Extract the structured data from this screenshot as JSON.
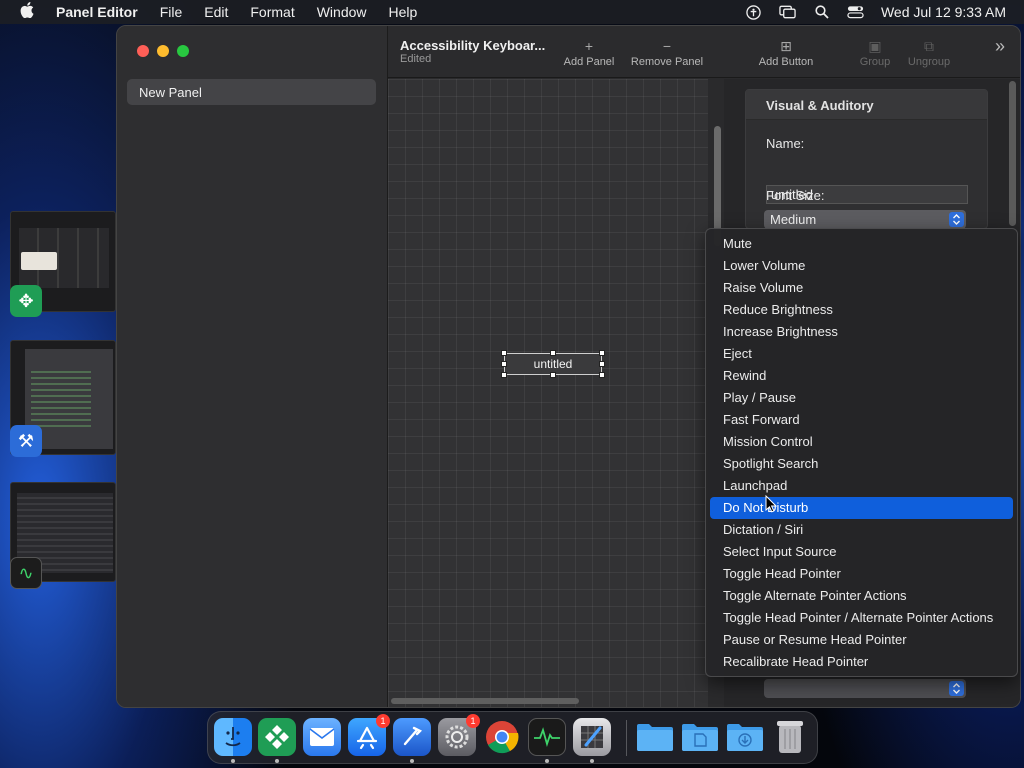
{
  "menubar": {
    "app_name": "Panel Editor",
    "menus": [
      "File",
      "Edit",
      "Format",
      "Window",
      "Help"
    ],
    "clock": "Wed Jul 12  9:33 AM",
    "status_icons": [
      "accessibility-icon",
      "screen-mirror-icon",
      "search-icon",
      "control-center-icon"
    ]
  },
  "sidebar": {
    "items": [
      {
        "label": "New Panel"
      }
    ]
  },
  "toolbar": {
    "doc_title": "Accessibility Keyboar...",
    "doc_status": "Edited",
    "buttons": [
      {
        "label": "Add Panel",
        "icon": "+",
        "enabled": true
      },
      {
        "label": "Remove Panel",
        "icon": "−",
        "enabled": true
      },
      {
        "label": "Add Button",
        "icon": "⊞",
        "enabled": true
      },
      {
        "label": "Group",
        "icon": "▣",
        "enabled": false
      },
      {
        "label": "Ungroup",
        "icon": "⧉",
        "enabled": false
      }
    ],
    "overflow_icon": "»"
  },
  "canvas": {
    "button_label": "untitled"
  },
  "inspector": {
    "section_title": "Visual & Auditory",
    "name_label": "Name:",
    "name_value": "untitled",
    "font_size_label": "Font Size:",
    "font_size_value": "Medium"
  },
  "dropdown": {
    "items": [
      "Mute",
      "Lower Volume",
      "Raise Volume",
      "Reduce Brightness",
      "Increase Brightness",
      "Eject",
      "Rewind",
      "Play / Pause",
      "Fast Forward",
      "Mission Control",
      "Spotlight Search",
      "Launchpad",
      "Do Not Disturb",
      "Dictation / Siri",
      "Select Input Source",
      "Toggle Head Pointer",
      "Toggle Alternate Pointer Actions",
      "Toggle Head Pointer / Alternate Pointer Actions",
      "Pause or Resume Head Pointer",
      "Recalibrate Head Pointer"
    ],
    "selected": "Do Not Disturb"
  },
  "dock": {
    "apps": [
      {
        "name": "finder-icon",
        "color": "#2a8cf5",
        "glyph": "☺"
      },
      {
        "name": "app-cluster-icon",
        "color": "#1f9d55",
        "glyph": "✥"
      },
      {
        "name": "mail-icon",
        "color": "#3f8cf2",
        "glyph": "✉"
      },
      {
        "name": "app-store-icon",
        "color": "#1b7cf3",
        "glyph": "A",
        "badge": "1"
      },
      {
        "name": "xcode-icon",
        "color": "#2c6cd8",
        "glyph": "⚒"
      },
      {
        "name": "system-settings-icon",
        "color": "#7a7a80",
        "glyph": "⚙",
        "badge": "1"
      },
      {
        "name": "chrome-icon",
        "color": "#e4e4e4",
        "glyph": "◉"
      },
      {
        "name": "activity-monitor-icon",
        "color": "#1c1c1c",
        "glyph": "∿"
      },
      {
        "name": "panel-editor-icon",
        "color": "#55555a",
        "glyph": "✎"
      },
      {
        "name": "folder-icon",
        "color": "#4aa5ec",
        "glyph": "▬"
      },
      {
        "name": "documents-folder-icon",
        "color": "#4aa5ec",
        "glyph": "▤"
      },
      {
        "name": "downloads-folder-icon",
        "color": "#4aa5ec",
        "glyph": "⇩"
      },
      {
        "name": "trash-icon",
        "color": "#8a8a8f",
        "glyph": "🗑"
      }
    ]
  },
  "colors": {
    "selection": "#0f5fdc",
    "close": "#fe5f57",
    "minimize": "#febc2e",
    "maximize": "#28c840"
  }
}
